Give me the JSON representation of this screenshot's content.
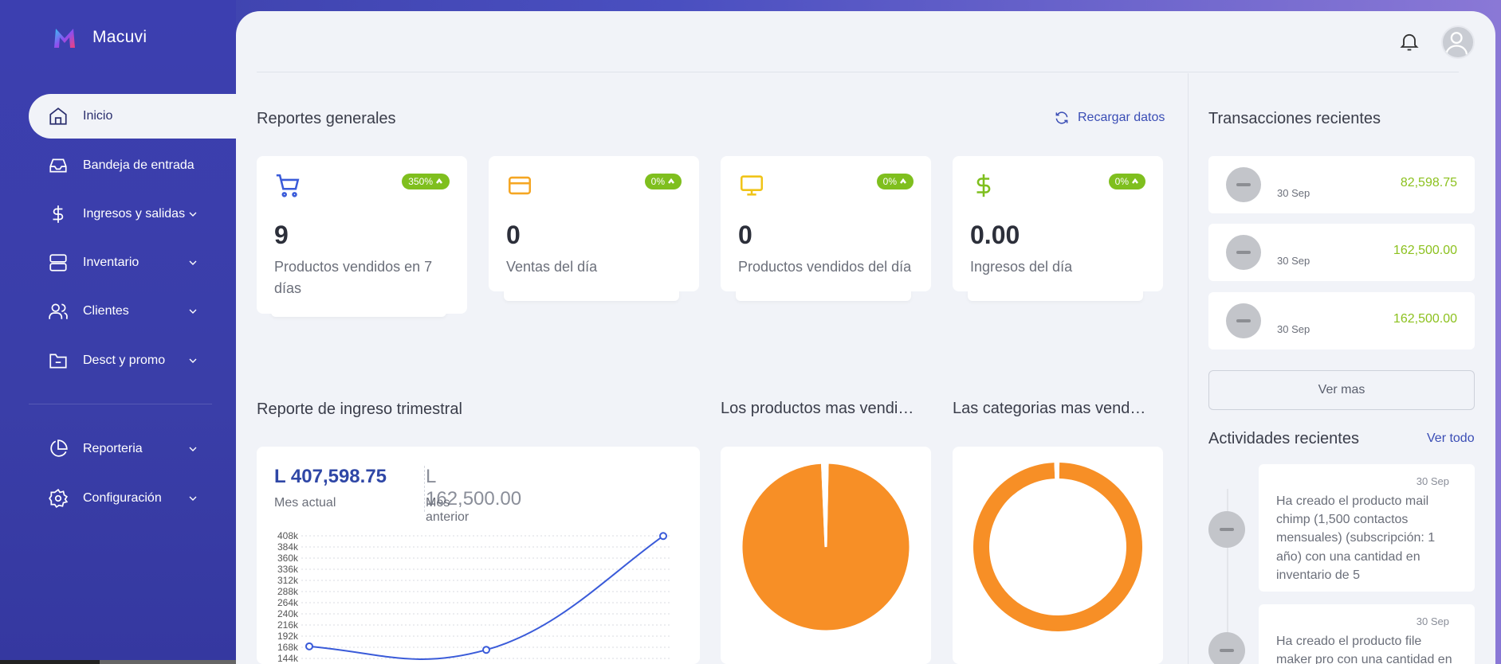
{
  "brand": {
    "name": "Macuvi"
  },
  "sidebar": {
    "items": [
      {
        "label": "Inicio",
        "icon": "home-icon",
        "active": true,
        "chevron": false
      },
      {
        "label": "Bandeja de entrada",
        "icon": "inbox-icon",
        "active": false,
        "chevron": false
      },
      {
        "label": "Ingresos y salidas",
        "icon": "dollar-icon",
        "active": false,
        "chevron": true
      },
      {
        "label": "Inventario",
        "icon": "server-icon",
        "active": false,
        "chevron": true
      },
      {
        "label": "Clientes",
        "icon": "users-icon",
        "active": false,
        "chevron": true
      },
      {
        "label": "Desct y promo",
        "icon": "folder-minus-icon",
        "active": false,
        "chevron": true
      },
      {
        "label": "Reporteria",
        "icon": "pie-chart-icon",
        "active": false,
        "chevron": true
      },
      {
        "label": "Configuración",
        "icon": "settings-icon",
        "active": false,
        "chevron": true
      }
    ]
  },
  "header": {
    "bell_icon": "bell-icon",
    "avatar_icon": "user-avatar-icon"
  },
  "reportes": {
    "title": "Reportes generales",
    "reload_label": "Recargar datos",
    "cards": [
      {
        "value": "9",
        "label": "Productos vendidos en 7 días",
        "badge": "350%",
        "icon": "cart-icon",
        "color": "#3a5bd9"
      },
      {
        "value": "0",
        "label": "Ventas del día",
        "badge": "0%",
        "icon": "credit-card-icon",
        "color": "#f5a623"
      },
      {
        "value": "0",
        "label": "Productos vendidos del día",
        "badge": "0%",
        "icon": "monitor-icon",
        "color": "#f0c419"
      },
      {
        "value": "0.00",
        "label": "Ingresos del día",
        "badge": "0%",
        "icon": "dollar-icon",
        "color": "#7fbf1e"
      }
    ]
  },
  "ingreso": {
    "title": "Reporte de ingreso trimestral",
    "current_value": "L 407,598.75",
    "current_label": "Mes actual",
    "previous_value": "L 162,500.00",
    "previous_label": "Mes anterior"
  },
  "productos_chart_title": "Los productos mas vendi…",
  "categorias_chart_title": "Las categorias mas vend…",
  "chart_data": [
    {
      "type": "line",
      "title": "",
      "y_ticks": [
        "408k",
        "384k",
        "360k",
        "336k",
        "312k",
        "288k",
        "264k",
        "240k",
        "216k",
        "192k",
        "168k",
        "144k"
      ],
      "ylim": [
        144000,
        408000
      ],
      "series": [
        {
          "values": [
            170000,
            162500,
            407598.75
          ]
        }
      ],
      "color": "#3a5bd9",
      "grid": true
    },
    {
      "type": "pie",
      "title": "",
      "slices": [
        {
          "value": 99
        },
        {
          "value": 1
        }
      ],
      "colors": [
        "#f78f26",
        "#ffffff"
      ]
    },
    {
      "type": "pie",
      "title": "",
      "slices": [
        {
          "value": 99
        },
        {
          "value": 1
        }
      ],
      "colors": [
        "#f78f26",
        "#ffffff"
      ],
      "donut": true
    }
  ],
  "transacciones": {
    "title": "Transacciones recientes",
    "items": [
      {
        "date": "30 Sep",
        "amount": "82,598.75"
      },
      {
        "date": "30 Sep",
        "amount": "162,500.00"
      },
      {
        "date": "30 Sep",
        "amount": "162,500.00"
      }
    ],
    "more_label": "Ver mas"
  },
  "actividades": {
    "title": "Actividades recientes",
    "view_all_label": "Ver todo",
    "items": [
      {
        "date": "30 Sep",
        "text": "Ha creado el producto mail chimp (1,500 contactos mensuales) (subscripción: 1 año) con una cantidad en inventario de 5"
      },
      {
        "date": "30 Sep",
        "text": "Ha creado el producto file maker pro con una cantidad en"
      }
    ]
  }
}
